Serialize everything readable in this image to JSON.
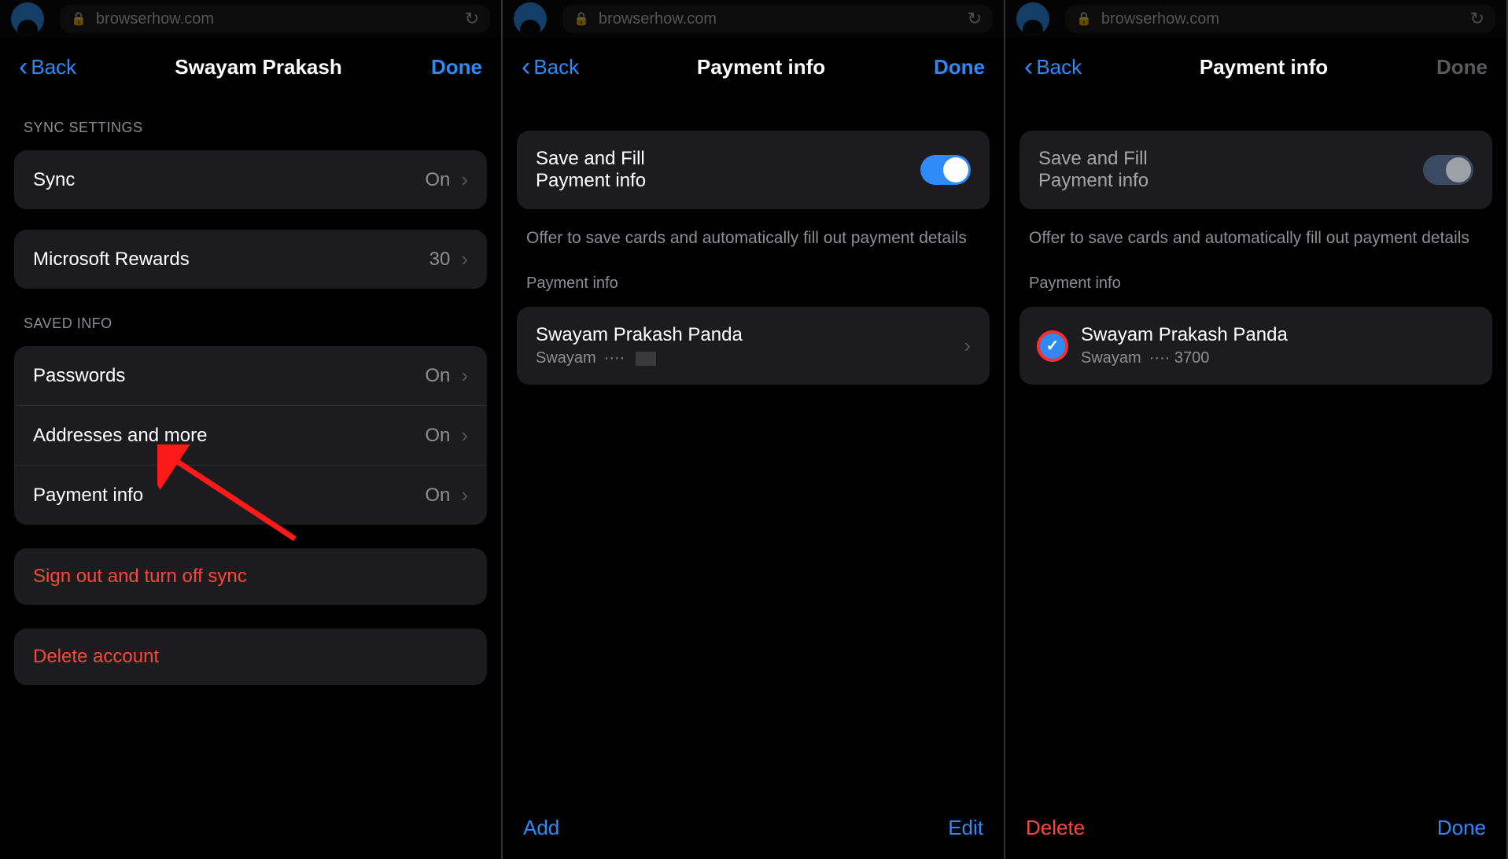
{
  "browser": {
    "url": "browserhow.com"
  },
  "panel1": {
    "back": "Back",
    "title": "Swayam Prakash",
    "done": "Done",
    "sections": {
      "sync_header": "SYNC SETTINGS",
      "sync_label": "Sync",
      "sync_value": "On",
      "rewards_label": "Microsoft Rewards",
      "rewards_value": "30",
      "saved_header": "SAVED INFO",
      "passwords_label": "Passwords",
      "passwords_value": "On",
      "addresses_label": "Addresses and more",
      "addresses_value": "On",
      "payment_label": "Payment info",
      "payment_value": "On",
      "signout_label": "Sign out and turn off sync",
      "delete_label": "Delete account"
    }
  },
  "panel2": {
    "back": "Back",
    "title": "Payment info",
    "done": "Done",
    "save_fill_line1": "Save and Fill",
    "save_fill_line2": "Payment info",
    "helper": "Offer to save cards and automatically fill out payment details",
    "section_header": "Payment info",
    "card_name": "Swayam Prakash Panda",
    "card_sub_name": "Swayam",
    "card_mask": "····",
    "bottom_left": "Add",
    "bottom_right": "Edit"
  },
  "panel3": {
    "back": "Back",
    "title": "Payment info",
    "done": "Done",
    "save_fill_line1": "Save and Fill",
    "save_fill_line2": "Payment info",
    "helper": "Offer to save cards and automatically fill out payment details",
    "section_header": "Payment info",
    "card_name": "Swayam Prakash Panda",
    "card_sub_name": "Swayam",
    "card_mask": "···· 3700",
    "bottom_left": "Delete",
    "bottom_right": "Done"
  },
  "arrow_color": "#ff1a1a"
}
